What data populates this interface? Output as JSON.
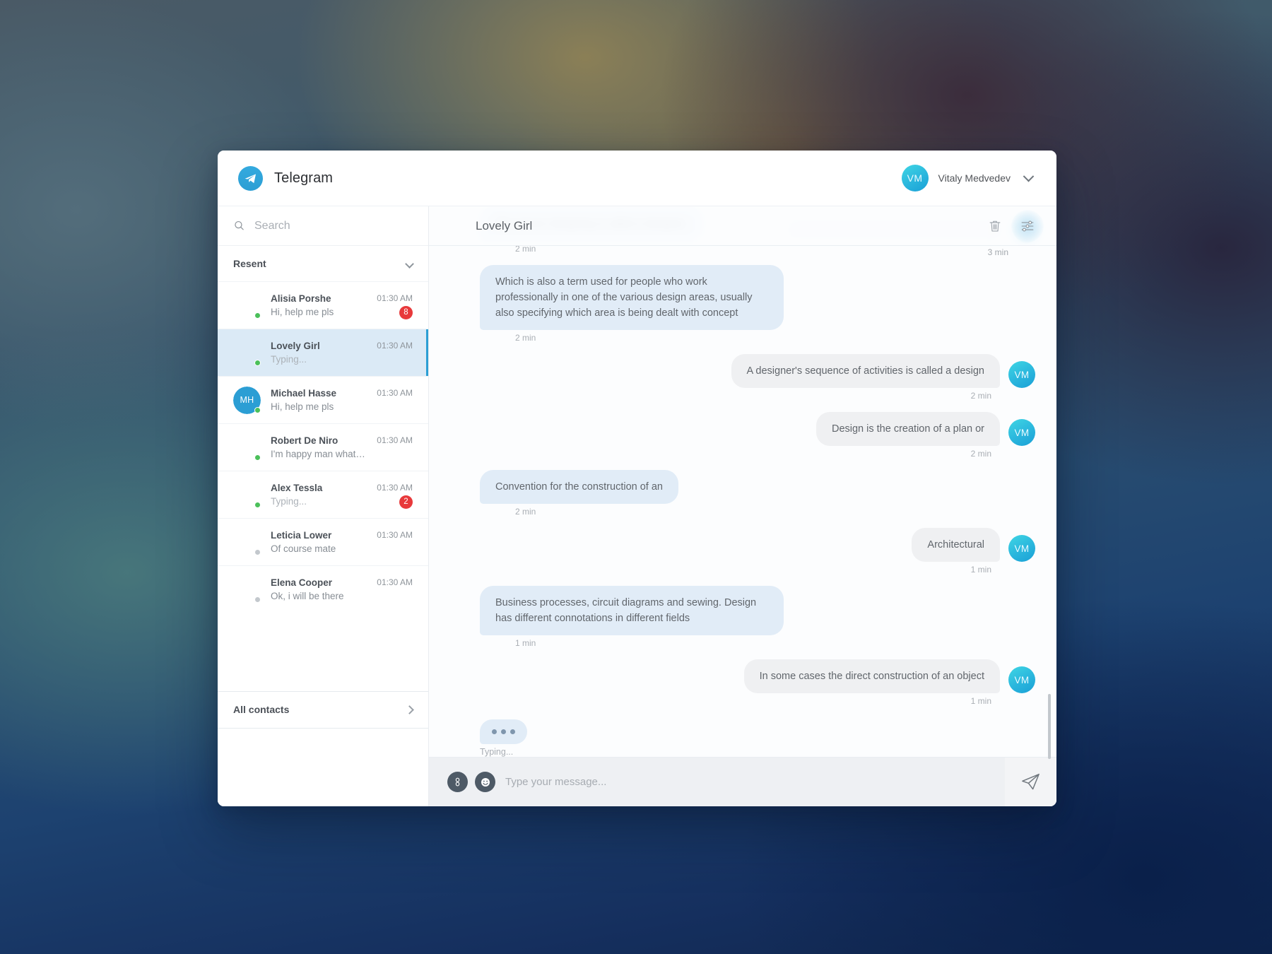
{
  "app": {
    "brand_name": "Telegram",
    "logo_icon": "telegram-paper-plane-icon"
  },
  "account": {
    "initials": "VM",
    "name": "Vitaly Medvedev",
    "chevron_icon": "chevron-down-icon"
  },
  "search": {
    "placeholder": "Search",
    "value": "",
    "icon": "search-icon"
  },
  "sidebar": {
    "section_label": "Resent",
    "section_chevron_icon": "chevron-down-icon",
    "all_contacts_label": "All contacts",
    "all_contacts_chevron_icon": "chevron-right-icon",
    "items": [
      {
        "name": "Alisia Porshe",
        "preview": "Hi, help me pls",
        "time": "01:30 AM",
        "badge": "8",
        "online": true,
        "selected": false,
        "typing": false,
        "avatar": "photo"
      },
      {
        "name": "Lovely Girl",
        "preview": "Typing...",
        "time": "01:30 AM",
        "badge": "",
        "online": true,
        "selected": true,
        "typing": true,
        "avatar": "photo"
      },
      {
        "name": "Michael Hasse",
        "preview": "Hi, help me pls",
        "time": "01:30 AM",
        "badge": "",
        "online": true,
        "selected": false,
        "typing": false,
        "avatar": "initials",
        "initials": "MH"
      },
      {
        "name": "Robert De Niro",
        "preview": "I'm happy man what u love it...",
        "time": "01:30 AM",
        "badge": "",
        "online": true,
        "selected": false,
        "typing": false,
        "avatar": "photo"
      },
      {
        "name": "Alex Tessla",
        "preview": "Typing...",
        "time": "01:30 AM",
        "badge": "2",
        "online": true,
        "selected": false,
        "typing": true,
        "avatar": "photo"
      },
      {
        "name": "Leticia Lower",
        "preview": "Of course mate",
        "time": "01:30 AM",
        "badge": "",
        "online": false,
        "selected": false,
        "typing": false,
        "avatar": "photo"
      },
      {
        "name": "Elena Cooper",
        "preview": "Ok, i will be there",
        "time": "01:30 AM",
        "badge": "",
        "online": false,
        "selected": false,
        "typing": false,
        "avatar": "photo"
      }
    ]
  },
  "chat": {
    "title": "Lovely Girl",
    "delete_icon": "trash-icon",
    "settings_icon": "sliders-icon",
    "scrolled_message_time": "3 min",
    "messages": [
      {
        "dir": "in",
        "text": "The person designing is called a designer,",
        "time": "2 min"
      },
      {
        "dir": "in",
        "text": "Which is also a term used for people who work professionally in one of the various design areas, usually also specifying which area is being dealt with concept",
        "time": "2 min"
      },
      {
        "dir": "out",
        "text": "A designer's sequence of activities is called a design",
        "time": "2 min"
      },
      {
        "dir": "out",
        "text": "Design is the creation of a plan or",
        "time": "2 min"
      },
      {
        "dir": "in",
        "text": "Convention for the construction of an",
        "time": "2 min"
      },
      {
        "dir": "out",
        "text": "Architectural",
        "time": "1 min"
      },
      {
        "dir": "in",
        "text": "Business processes, circuit diagrams and sewing. Design has different connotations in different fields",
        "time": "1 min"
      },
      {
        "dir": "out",
        "text": "In some cases the direct construction of an object",
        "time": "1 min"
      }
    ],
    "typing_label": "Typing..."
  },
  "composer": {
    "attach_icon": "link-chain-icon",
    "emoji_icon": "smiley-icon",
    "placeholder": "Type your message...",
    "value": "",
    "send_icon": "send-paper-plane-icon"
  },
  "colors": {
    "accent": "#2b9ed4",
    "badge": "#e8393b",
    "incoming_bubble": "#e1ecf7",
    "outgoing_bubble": "#eff0f2",
    "online_dot": "#4bc05a",
    "offline_dot": "#c3c8cd"
  }
}
